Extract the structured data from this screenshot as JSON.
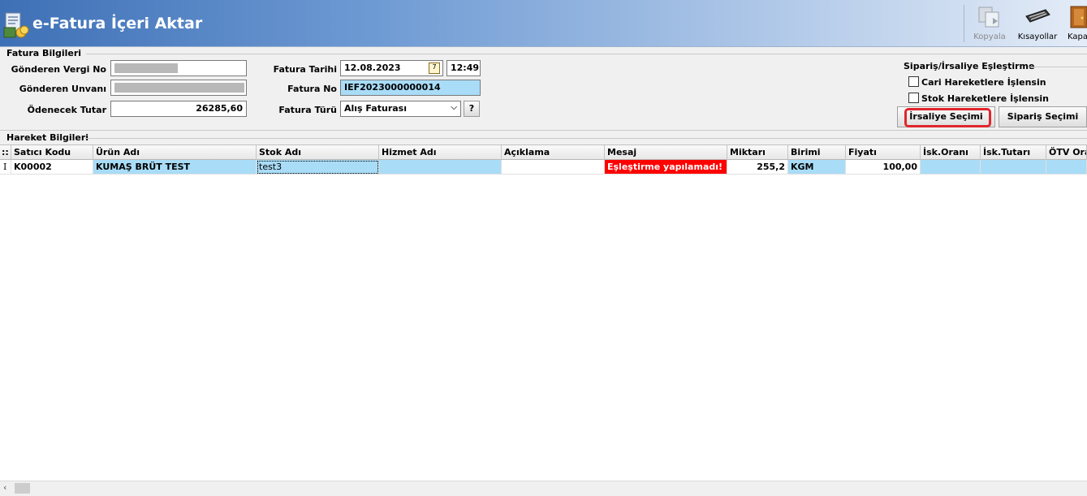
{
  "app": {
    "title": "e-Fatura İçeri Aktar"
  },
  "toolbar": {
    "copy_label": "Kopyala",
    "shortcuts_label": "Kısayollar",
    "close_label": "Kapat"
  },
  "invoice_info": {
    "group_title": "Fatura Bilgileri",
    "sender_tax_no_label": "Gönderen Vergi No",
    "sender_title_label": "Gönderen Unvanı",
    "amount_label": "Ödenecek Tutar",
    "amount_value": "26285,60",
    "date_label": "Fatura Tarihi",
    "date_value": "12.08.2023",
    "time_value": "12:49",
    "invoice_no_label": "Fatura No",
    "invoice_no_value": "IEF2023000000014",
    "invoice_type_label": "Fatura Türü",
    "invoice_type_value": "Alış Faturası",
    "help_label": "?"
  },
  "matching": {
    "group_title": "Sipariş/İrsaliye Eşleştirme",
    "cari_label": "Cari Hareketlere İşlensin",
    "stok_label": "Stok Hareketlere İşlensin",
    "irsaliye_button": "İrsaliye Seçimi",
    "siparis_button": "Sipariş Seçimi"
  },
  "movements": {
    "group_title": "Hareket Bilgileri",
    "indicator_header": "::",
    "columns": [
      "Satıcı Kodu",
      "Ürün Adı",
      "Stok Adı",
      "Hizmet Adı",
      "Açıklama",
      "Mesaj",
      "Miktarı",
      "Birimi",
      "Fiyatı",
      "İsk.Oranı",
      "İsk.Tutarı",
      "ÖTV Oranı"
    ],
    "rows": [
      {
        "indicator": "I",
        "cells": [
          "K00002",
          "KUMAŞ BRÜT TEST",
          "test3",
          "",
          "",
          "Eşleştirme yapılamadı!",
          "255,2",
          "KGM",
          "100,00",
          "",
          "",
          ""
        ]
      }
    ]
  },
  "colors": {
    "highlight_blue": "#a9dcf7",
    "error_red": "#ff0000",
    "annotation_red": "#e0262c"
  }
}
